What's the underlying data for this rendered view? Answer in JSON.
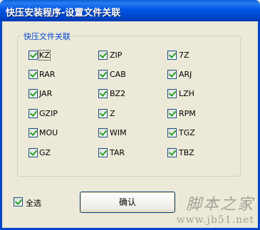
{
  "window": {
    "title": "快压安装程序-设置文件关联"
  },
  "group": {
    "label": "快压文件关联",
    "items": [
      {
        "label": "KZ",
        "checked": true
      },
      {
        "label": "ZIP",
        "checked": true
      },
      {
        "label": "7Z",
        "checked": true
      },
      {
        "label": "RAR",
        "checked": true
      },
      {
        "label": "CAB",
        "checked": true
      },
      {
        "label": "ARJ",
        "checked": true
      },
      {
        "label": "JAR",
        "checked": true
      },
      {
        "label": "BZ2",
        "checked": true
      },
      {
        "label": "LZH",
        "checked": true
      },
      {
        "label": "GZIP",
        "checked": true
      },
      {
        "label": "Z",
        "checked": true
      },
      {
        "label": "RPM",
        "checked": true
      },
      {
        "label": "MOU",
        "checked": true
      },
      {
        "label": "WIM",
        "checked": true
      },
      {
        "label": "TGZ",
        "checked": true
      },
      {
        "label": "GZ",
        "checked": true
      },
      {
        "label": "TAR",
        "checked": true
      },
      {
        "label": "TBZ",
        "checked": true
      }
    ]
  },
  "select_all": {
    "label": "全选",
    "checked": true
  },
  "confirm_button": {
    "label": "确认"
  },
  "watermark": {
    "line1": "脚本之家",
    "line2": "www.jb51.net"
  }
}
